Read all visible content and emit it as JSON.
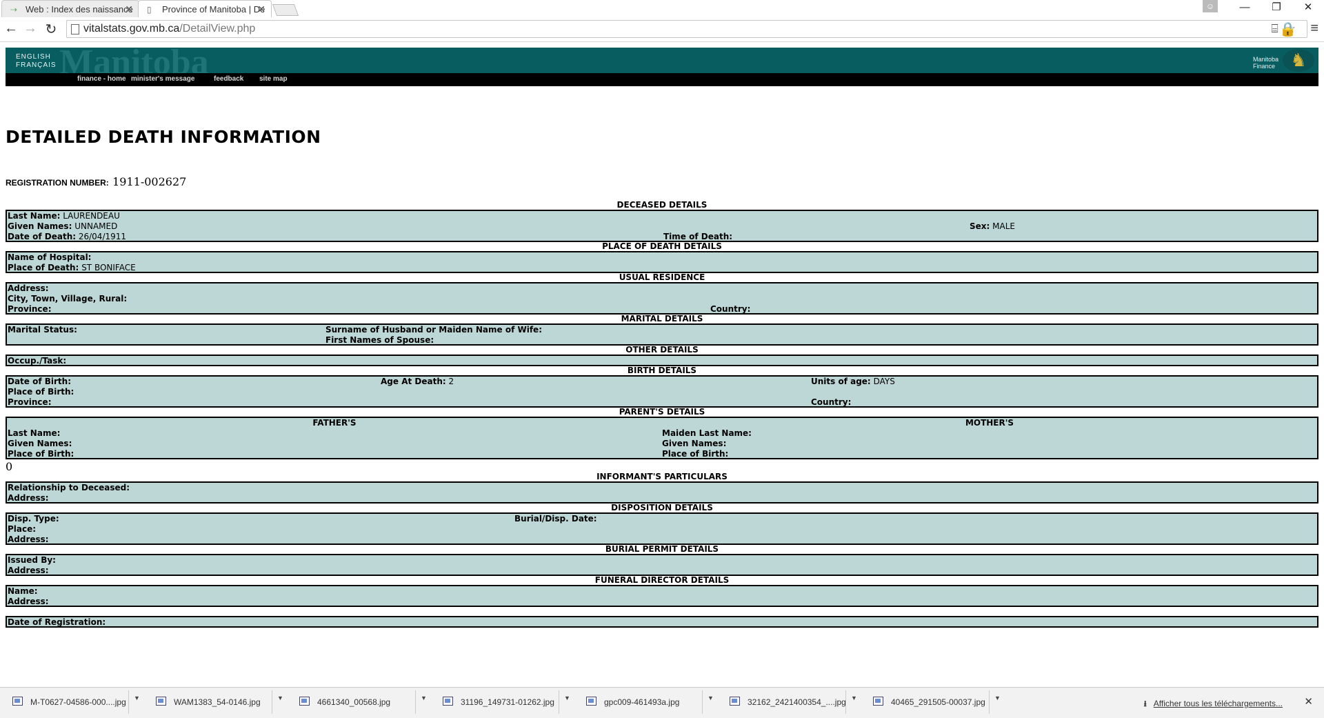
{
  "browser": {
    "tabs": [
      {
        "label": "Web : Index des naissance",
        "active": false
      },
      {
        "label": "Province of Manitoba | De",
        "active": true
      }
    ],
    "url_host": "vitalstats.gov.mb.ca",
    "url_path": "/DetailView.php"
  },
  "site": {
    "lang_en": "ENGLISH",
    "lang_fr": "FRANÇAIS",
    "watermark": "Manitoba",
    "brand_line1": "Manitoba",
    "brand_line2": "Finance",
    "nav": [
      "finance - home",
      "minister's message",
      "feedback",
      "site map"
    ],
    "header_color": "#085d60"
  },
  "page": {
    "title": "DETAILED DEATH INFORMATION",
    "reg_label": "REGISTRATION NUMBER:",
    "reg_value": "1911-002627",
    "stray_value": "0"
  },
  "sections": {
    "deceased": {
      "title": "DECEASED DETAILS",
      "last_name_label": "Last Name:",
      "last_name": "LAURENDEAU",
      "given_names_label": "Given Names:",
      "given_names": "UNNAMED",
      "sex_label": "Sex:",
      "sex": "MALE",
      "dod_label": "Date of Death:",
      "dod": "26/04/1911",
      "tod_label": "Time of Death:",
      "tod": ""
    },
    "place_of_death": {
      "title": "PLACE OF DEATH DETAILS",
      "hospital_label": "Name of Hospital:",
      "hospital": "",
      "place_label": "Place of Death:",
      "place": "ST BONIFACE"
    },
    "residence": {
      "title": "USUAL RESIDENCE",
      "address_label": "Address:",
      "city_label": "City, Town, Village, Rural:",
      "province_label": "Province:",
      "country_label": "Country:"
    },
    "marital": {
      "title": "MARITAL DETAILS",
      "status_label": "Marital Status:",
      "surname_label": "Surname of Husband or Maiden Name of Wife:",
      "spouse_label": "First Names of Spouse:"
    },
    "other": {
      "title": "OTHER DETAILS",
      "occ_label": "Occup./Task:"
    },
    "birth": {
      "title": "BIRTH DETAILS",
      "dob_label": "Date of Birth:",
      "age_label": "Age At Death:",
      "age": "2",
      "units_label": "Units of age:",
      "units": "DAYS",
      "pob_label": "Place of Birth:",
      "province_label": "Province:",
      "country_label": "Country:"
    },
    "parents": {
      "title": "PARENT'S DETAILS",
      "father_heading": "FATHER'S",
      "mother_heading": "MOTHER'S",
      "f_last_label": "Last Name:",
      "f_given_label": "Given Names:",
      "f_pob_label": "Place of Birth:",
      "m_maiden_label": "Maiden Last Name:",
      "m_given_label": "Given Names:",
      "m_pob_label": "Place of Birth:"
    },
    "informant": {
      "title": "INFORMANT'S PARTICULARS",
      "rel_label": "Relationship to Deceased:",
      "address_label": "Address:"
    },
    "disposition": {
      "title": "DISPOSITION DETAILS",
      "type_label": "Disp. Type:",
      "date_label": "Burial/Disp. Date:",
      "place_label": "Place:",
      "address_label": "Address:"
    },
    "permit": {
      "title": "BURIAL PERMIT DETAILS",
      "issued_label": "Issued By:",
      "address_label": "Address:"
    },
    "funeral": {
      "title": "FUNERAL DIRECTOR DETAILS",
      "name_label": "Name:",
      "address_label": "Address:"
    },
    "registration": {
      "date_label": "Date of Registration:"
    }
  },
  "downloads": {
    "files": [
      "M-T0627-04586-000....jpg",
      "WAM1383_54-0146.jpg",
      "4661340_00568.jpg",
      "31196_149731-01262.jpg",
      "gpc009-461493a.jpg",
      "32162_2421400354_....jpg",
      "40465_291505-00037.jpg"
    ],
    "show_all": "Afficher tous les téléchargements..."
  }
}
